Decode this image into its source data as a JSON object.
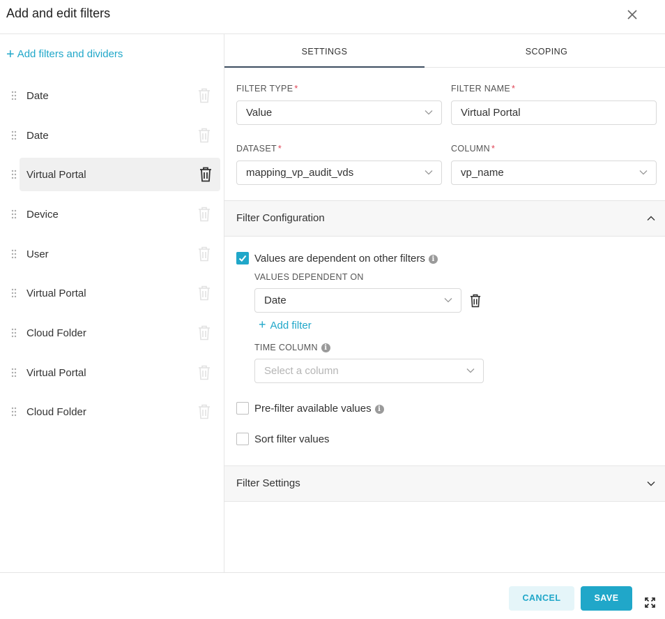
{
  "modal": {
    "title": "Add and edit filters"
  },
  "sidebar": {
    "add_label": "Add filters and dividers",
    "items": [
      {
        "label": "Date"
      },
      {
        "label": "Date"
      },
      {
        "label": "Virtual Portal",
        "active": true
      },
      {
        "label": "Device"
      },
      {
        "label": "User"
      },
      {
        "label": "Virtual Portal"
      },
      {
        "label": "Cloud Folder"
      },
      {
        "label": "Virtual Portal"
      },
      {
        "label": "Cloud Folder"
      }
    ]
  },
  "tabs": [
    {
      "label": "SETTINGS",
      "active": true
    },
    {
      "label": "SCOPING"
    }
  ],
  "form": {
    "filter_type_label": "FILTER TYPE",
    "filter_type_value": "Value",
    "filter_name_label": "FILTER NAME",
    "filter_name_value": "Virtual Portal",
    "dataset_label": "DATASET",
    "dataset_value": "mapping_vp_audit_vds",
    "column_label": "COLUMN",
    "column_value": "vp_name",
    "required_mark": "*"
  },
  "filter_configuration": {
    "title": "Filter Configuration",
    "dependent_label": "Values are dependent on other filters",
    "dependent_checked": true,
    "values_dependent_on_label": "VALUES DEPENDENT ON",
    "dependent_on_value": "Date",
    "add_filter_label": "Add filter",
    "time_column_label": "TIME COLUMN",
    "time_column_placeholder": "Select a column",
    "prefilter_label": "Pre-filter available values",
    "prefilter_checked": false,
    "sort_label": "Sort filter values",
    "sort_checked": false
  },
  "filter_settings": {
    "title": "Filter Settings"
  },
  "footer": {
    "cancel_label": "CANCEL",
    "save_label": "SAVE"
  },
  "colors": {
    "accent": "#20a7c9",
    "required": "#e04355",
    "active_tab_underline": "#3c4d60"
  },
  "icons": {
    "close": "close-icon",
    "drag": "drag-handle-icon",
    "trash": "trash-icon",
    "chevron": "chevron-down-icon",
    "info": "info-icon",
    "expand": "expand-icon"
  }
}
